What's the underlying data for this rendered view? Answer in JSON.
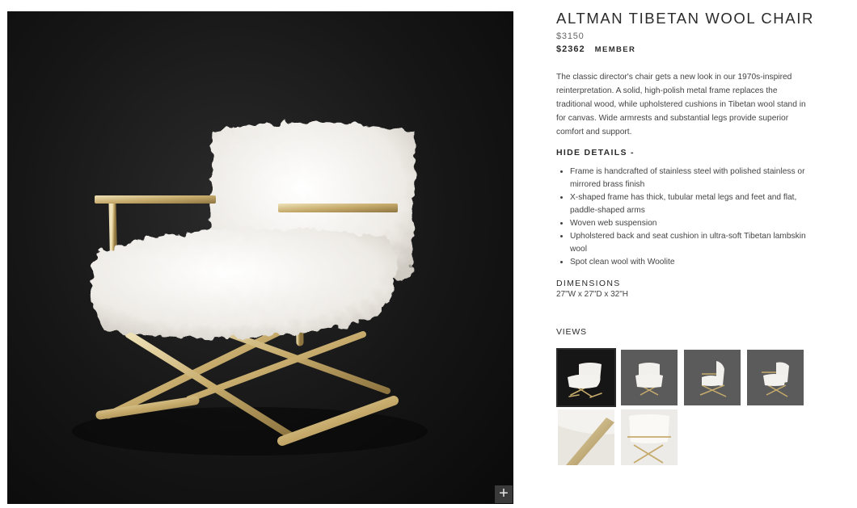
{
  "product": {
    "title": "ALTMAN TIBETAN WOOL CHAIR",
    "price_regular": "$3150",
    "price_member": "$2362",
    "member_label": "MEMBER",
    "description": "The classic director's chair gets a new look in our 1970s-inspired reinterpretation. A solid, high-polish metal frame replaces the traditional wood, while upholstered cushions in Tibetan wool stand in for canvas. Wide armrests and substantial legs provide superior comfort and support.",
    "details_toggle": "HIDE DETAILS -",
    "details": [
      "Frame is handcrafted of stainless steel with polished stainless or mirrored brass finish",
      "X-shaped frame has thick, tubular metal legs and feet and flat, paddle-shaped arms",
      "Woven web suspension",
      "Upholstered back and seat cushion in ultra-soft Tibetan lambskin wool",
      "Spot clean wool with Woolite"
    ],
    "dimensions_title": "DIMENSIONS",
    "dimensions_value": "27\"W x 27\"D x 32\"H"
  },
  "views": {
    "title": "VIEWS",
    "thumbnails": [
      {
        "label": "front-angle-dark",
        "selected": true
      },
      {
        "label": "front-grey",
        "selected": false
      },
      {
        "label": "side-grey",
        "selected": false
      },
      {
        "label": "angle-grey",
        "selected": false
      },
      {
        "label": "detail-arm",
        "selected": false
      },
      {
        "label": "back-light",
        "selected": false
      }
    ]
  },
  "hero": {
    "zoom_icon": "plus-icon",
    "zoom_glyph": "+"
  },
  "colors": {
    "background_dark": "#141414",
    "brass": "#c9b27a",
    "wool": "#f2f0ec",
    "thumb_grey": "#5b5b5b"
  }
}
